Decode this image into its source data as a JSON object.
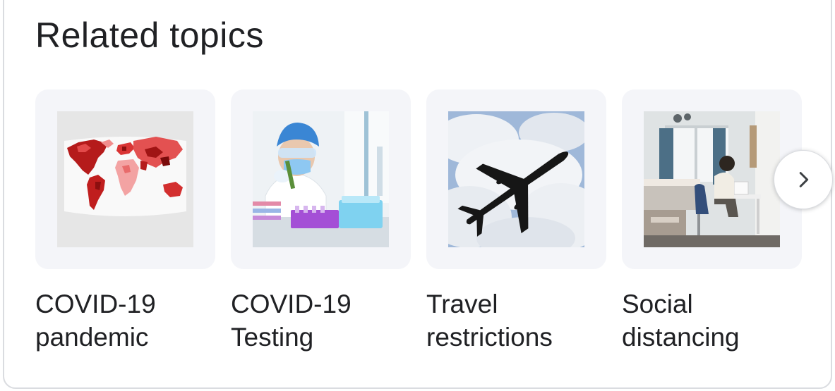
{
  "section": {
    "title": "Related topics"
  },
  "topics": [
    {
      "label": "COVID-19 pandemic",
      "image": "world-map-covid-thumbnail"
    },
    {
      "label": "COVID-19 Testing",
      "image": "lab-technician-thumbnail"
    },
    {
      "label": "Travel restrictions",
      "image": "airplane-clouds-thumbnail"
    },
    {
      "label": "Social distancing",
      "image": "home-office-thumbnail"
    }
  ],
  "carousel": {
    "next_icon": "chevron-right-icon"
  },
  "colors": {
    "text": "#202124",
    "card_bg": "#f4f5f9",
    "border": "#dadce0",
    "icon": "#3c4043"
  }
}
